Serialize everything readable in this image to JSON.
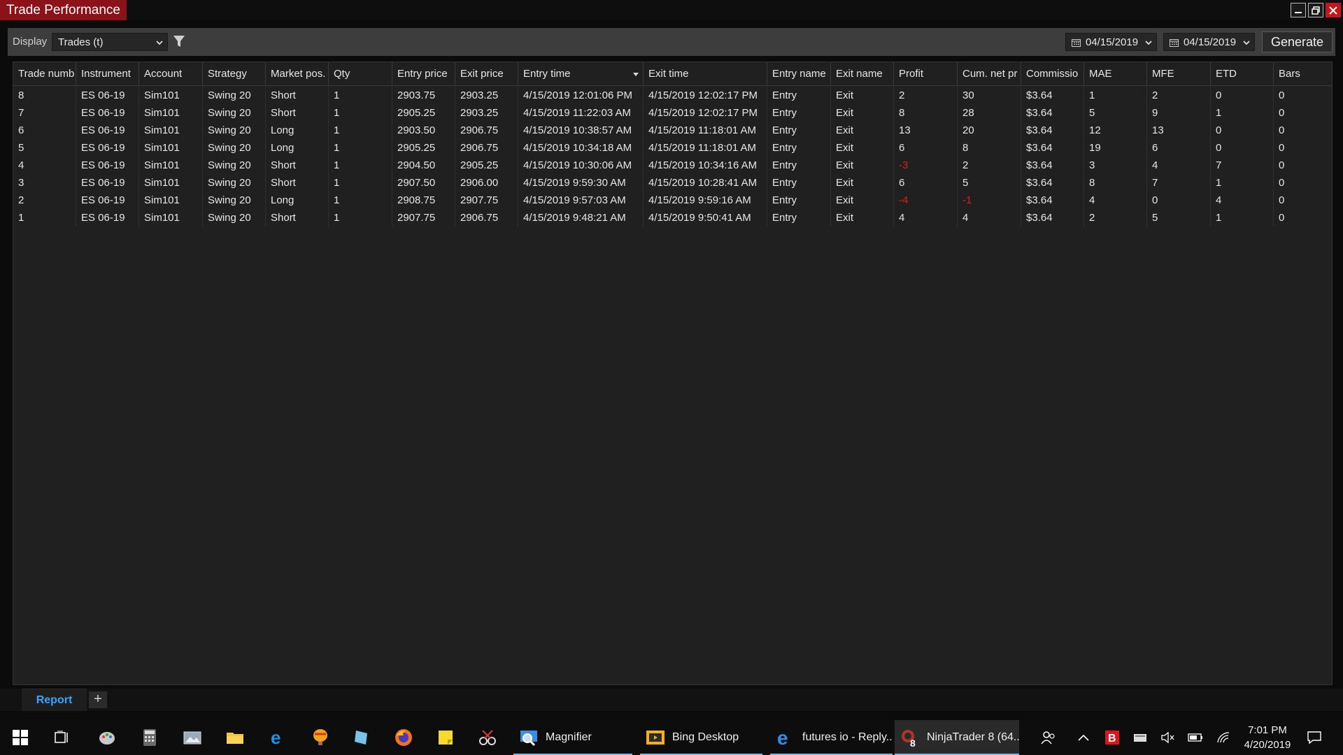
{
  "window": {
    "title": "Trade Performance"
  },
  "toolbar": {
    "display_label": "Display",
    "display_value": "Trades (t)",
    "date_from": "04/15/2019",
    "date_to": "04/15/2019",
    "generate_label": "Generate"
  },
  "grid": {
    "columns": [
      "Trade numb",
      "Instrument",
      "Account",
      "Strategy",
      "Market pos.",
      "Qty",
      "Entry price",
      "Exit price",
      "Entry time",
      "Exit time",
      "Entry name",
      "Exit name",
      "Profit",
      "Cum. net pr",
      "Commissio",
      "MAE",
      "MFE",
      "ETD",
      "Bars"
    ],
    "rows": [
      [
        "8",
        "ES 06-19",
        "Sim101",
        "Swing 20",
        "Short",
        "1",
        "2903.75",
        "2903.25",
        "4/15/2019 12:01:06 PM",
        "4/15/2019 12:02:17 PM",
        "Entry",
        "Exit",
        "2",
        "30",
        "$3.64",
        "1",
        "2",
        "0",
        "0"
      ],
      [
        "7",
        "ES 06-19",
        "Sim101",
        "Swing 20",
        "Short",
        "1",
        "2905.25",
        "2903.25",
        "4/15/2019 11:22:03 AM",
        "4/15/2019 12:02:17 PM",
        "Entry",
        "Exit",
        "8",
        "28",
        "$3.64",
        "5",
        "9",
        "1",
        "0"
      ],
      [
        "6",
        "ES 06-19",
        "Sim101",
        "Swing 20",
        "Long",
        "1",
        "2903.50",
        "2906.75",
        "4/15/2019 10:38:57 AM",
        "4/15/2019 11:18:01 AM",
        "Entry",
        "Exit",
        "13",
        "20",
        "$3.64",
        "12",
        "13",
        "0",
        "0"
      ],
      [
        "5",
        "ES 06-19",
        "Sim101",
        "Swing 20",
        "Long",
        "1",
        "2905.25",
        "2906.75",
        "4/15/2019 10:34:18 AM",
        "4/15/2019 11:18:01 AM",
        "Entry",
        "Exit",
        "6",
        "8",
        "$3.64",
        "19",
        "6",
        "0",
        "0"
      ],
      [
        "4",
        "ES 06-19",
        "Sim101",
        "Swing 20",
        "Short",
        "1",
        "2904.50",
        "2905.25",
        "4/15/2019 10:30:06 AM",
        "4/15/2019 10:34:16 AM",
        "Entry",
        "Exit",
        "-3",
        "2",
        "$3.64",
        "3",
        "4",
        "7",
        "0"
      ],
      [
        "3",
        "ES 06-19",
        "Sim101",
        "Swing 20",
        "Short",
        "1",
        "2907.50",
        "2906.00",
        "4/15/2019 9:59:30 AM",
        "4/15/2019 10:28:41 AM",
        "Entry",
        "Exit",
        "6",
        "5",
        "$3.64",
        "8",
        "7",
        "1",
        "0"
      ],
      [
        "2",
        "ES 06-19",
        "Sim101",
        "Swing 20",
        "Long",
        "1",
        "2908.75",
        "2907.75",
        "4/15/2019 9:57:03 AM",
        "4/15/2019 9:59:16 AM",
        "Entry",
        "Exit",
        "-4",
        "-1",
        "$3.64",
        "4",
        "0",
        "4",
        "0"
      ],
      [
        "1",
        "ES 06-19",
        "Sim101",
        "Swing 20",
        "Short",
        "1",
        "2907.75",
        "2906.75",
        "4/15/2019 9:48:21 AM",
        "4/15/2019 9:50:41 AM",
        "Entry",
        "Exit",
        "4",
        "4",
        "$3.64",
        "2",
        "5",
        "1",
        "0"
      ]
    ]
  },
  "tabs": {
    "report_label": "Report",
    "add_label": "+"
  },
  "taskbar": {
    "apps": [
      {
        "label": "Magnifier",
        "icon": "magnifier-icon"
      },
      {
        "label": "Bing Desktop",
        "icon": "bing-desktop-icon"
      },
      {
        "label": "futures io - Reply...",
        "icon": "edge-icon"
      },
      {
        "label": "NinjaTrader 8 (64...",
        "icon": "ninjatrader-icon"
      }
    ],
    "time": "7:01 PM",
    "date": "4/20/2019"
  },
  "colors": {
    "title_accent": "#8b1218",
    "negative": "#e01b1b",
    "tab_active": "#3aa3ff"
  }
}
